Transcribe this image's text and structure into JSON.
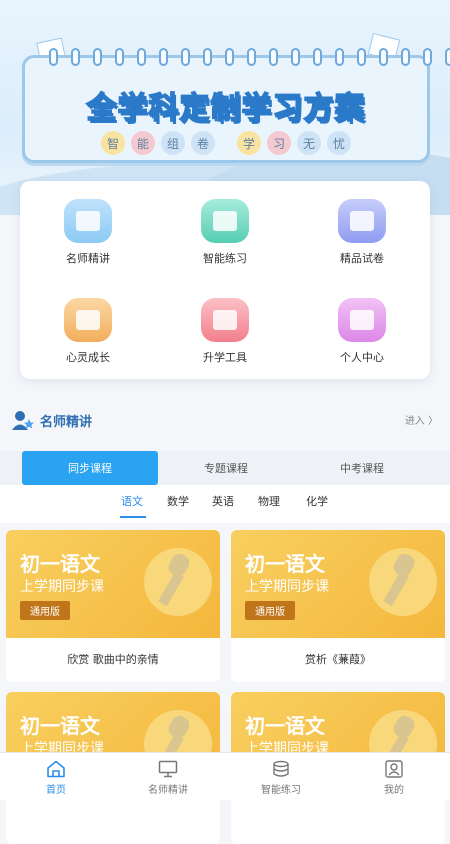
{
  "banner": {
    "title": "全学科定制学习方案",
    "subtitle_chars": [
      "智",
      "能",
      "组",
      "卷",
      "学",
      "习",
      "无",
      "忧"
    ]
  },
  "menu": [
    {
      "label": "名师精讲",
      "icon": "video-lesson-icon",
      "color": "#8cc9f3"
    },
    {
      "label": "智能练习",
      "icon": "practice-book-icon",
      "color": "#56cdb3"
    },
    {
      "label": "精品试卷",
      "icon": "exam-paper-icon",
      "color": "#8f9cf1"
    },
    {
      "label": "心灵成长",
      "icon": "growth-bag-icon",
      "color": "#f2ae5c"
    },
    {
      "label": "升学工具",
      "icon": "graduation-cap-icon",
      "color": "#f27f8c"
    },
    {
      "label": "个人中心",
      "icon": "person-icon",
      "color": "#dc87e7"
    }
  ],
  "section": {
    "title": "名师精讲",
    "more": "进入 〉"
  },
  "tabs": [
    "同步课程",
    "专题课程",
    "中考课程"
  ],
  "subjects": [
    "语文",
    "数学",
    "英语",
    "物理",
    "化学"
  ],
  "courses": [
    {
      "title": "初一语文",
      "sub": "上学期同步课",
      "badge": "通用版",
      "name": "欣赏 歌曲中的亲情"
    },
    {
      "title": "初一语文",
      "sub": "上学期同步课",
      "badge": "通用版",
      "name": "赏析《蒹葭》"
    },
    {
      "title": "初一语文",
      "sub": "上学期同步课",
      "badge": "",
      "name": ""
    },
    {
      "title": "初一语文",
      "sub": "上学期同步课",
      "badge": "",
      "name": ""
    }
  ],
  "nav": [
    "首页",
    "名师精讲",
    "智能练习",
    "我的"
  ],
  "colors": {
    "accent": "#2aa3f2",
    "section_title": "#2f6fb3",
    "course_cover": "#f4b73c"
  }
}
